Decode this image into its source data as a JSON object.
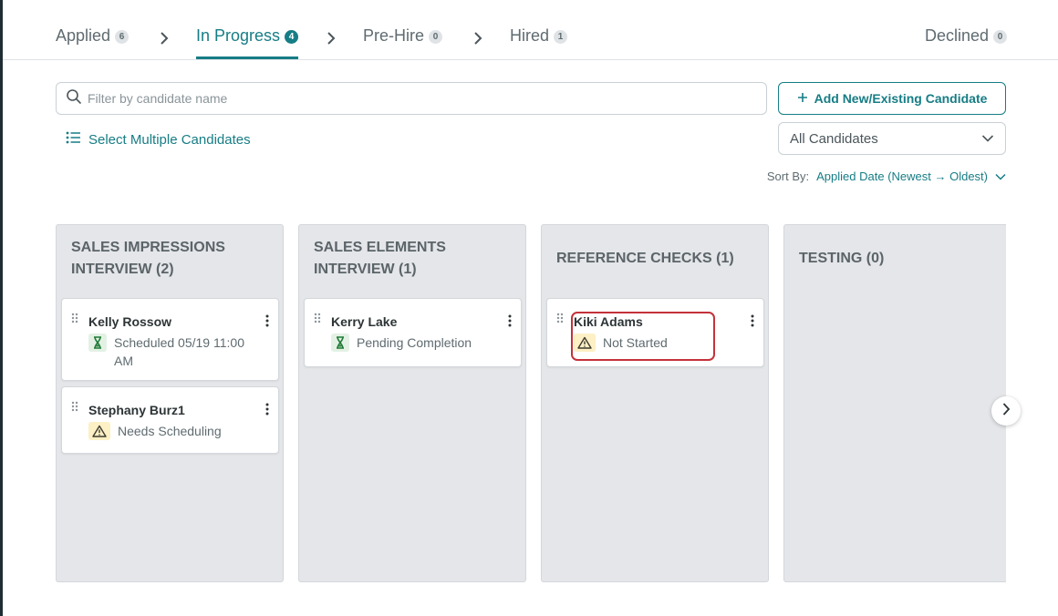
{
  "tabs": [
    {
      "label": "Applied",
      "count": "6"
    },
    {
      "label": "In Progress",
      "count": "4"
    },
    {
      "label": "Pre-Hire",
      "count": "0"
    },
    {
      "label": "Hired",
      "count": "1"
    },
    {
      "label": "Declined",
      "count": "0"
    }
  ],
  "active_tab": "In Progress",
  "filter": {
    "placeholder": "Filter by candidate name",
    "value": "",
    "icon": "search-icon"
  },
  "add_button": {
    "label": "Add New/Existing Candidate",
    "icon": "plus-icon"
  },
  "select_multiple": {
    "label": "Select Multiple Candidates",
    "icon": "list-icon"
  },
  "candidates_dropdown": {
    "selected": "All Candidates"
  },
  "sort": {
    "label": "Sort By:",
    "value": "Applied Date (Newest → Oldest)"
  },
  "columns": [
    {
      "title": "SALES IMPRESSIONS INTERVIEW (2)",
      "cards": [
        {
          "name": "Kelly Rossow",
          "status": "Scheduled 05/19 11:00 AM",
          "status_icon": "hourglass-icon"
        },
        {
          "name": "Stephany Burz1",
          "status": "Needs Scheduling",
          "status_icon": "warning-icon"
        }
      ]
    },
    {
      "title": "SALES ELEMENTS INTERVIEW (1)",
      "cards": [
        {
          "name": "Kerry Lake",
          "status": "Pending Completion",
          "status_icon": "hourglass-icon"
        }
      ]
    },
    {
      "title": "REFERENCE CHECKS (1)",
      "cards": [
        {
          "name": "Kiki Adams",
          "status": "Not Started",
          "status_icon": "warning-icon"
        }
      ]
    },
    {
      "title": "TESTING (0)",
      "cards": []
    }
  ],
  "colors": {
    "accent": "#167d85",
    "column_bg": "#e4e6e9",
    "warning_bg": "#fdf0c4",
    "success_bg": "#e3f1e4",
    "highlight": "#c4323a"
  }
}
